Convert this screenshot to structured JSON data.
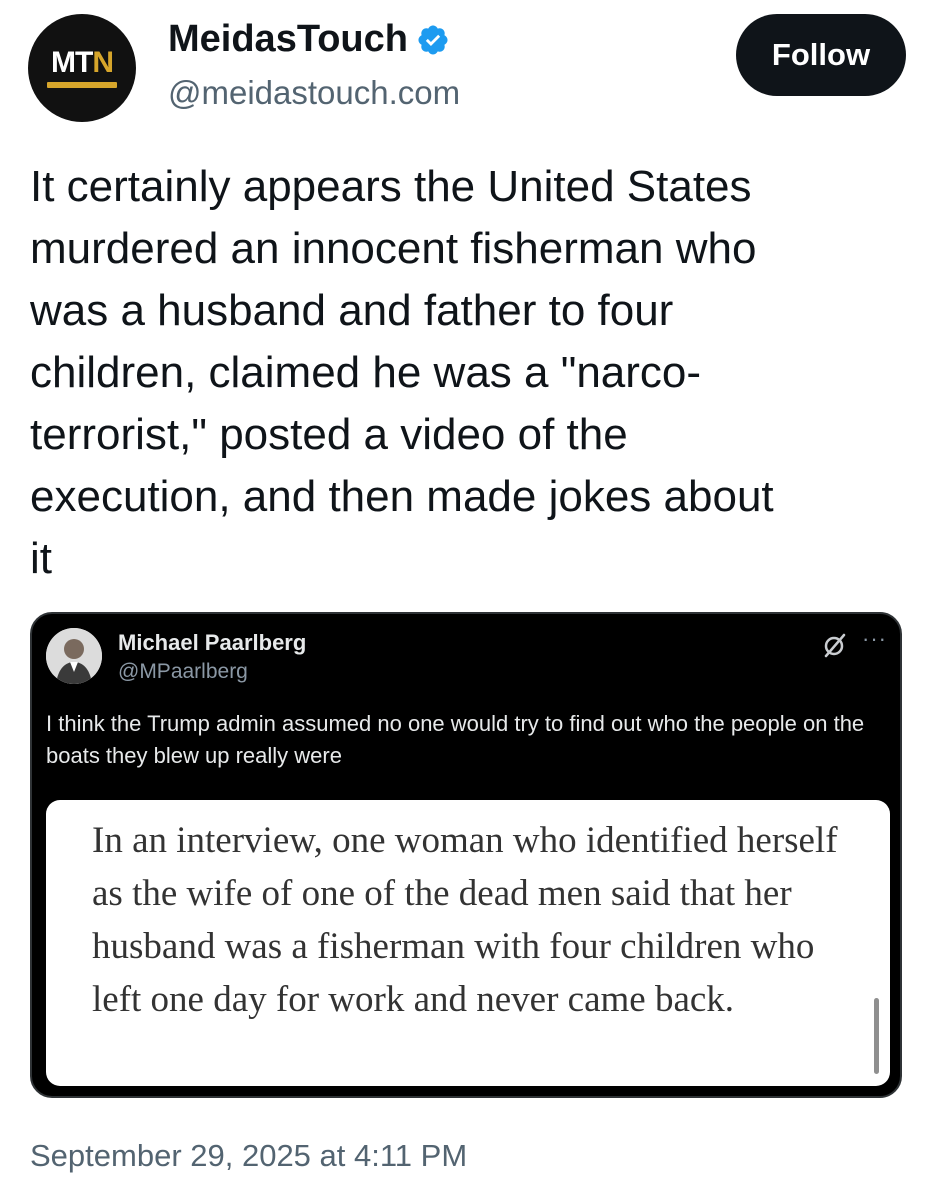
{
  "header": {
    "avatar_logo_text": "MTN",
    "display_name": "MeidasTouch",
    "handle": "@meidastouch.com",
    "verified_icon": "verified-badge-icon",
    "follow_label": "Follow"
  },
  "post": {
    "text": "It certainly appears the United States\nmurdered an innocent fisherman who\nwas a husband and father to four\nchildren, claimed he was a \"narco-\nterrorist,\" posted a video of the\nexecution, and then made jokes about\nit",
    "timestamp": "September 29, 2025 at 4:11 PM"
  },
  "quote": {
    "name": "Michael Paarlberg",
    "handle": "@MPaarlberg",
    "text": "I think the Trump admin assumed no one would try to find out who the people on the boats they blew up really were",
    "more_label": "···",
    "image_text": "In an interview, one woman who identified herself as the wife of one of the dead men said that her husband was a fisherman with four children who left one day for work and never came back."
  },
  "colors": {
    "accent_verified": "#1d9bf0",
    "follow_bg": "#0f1419",
    "quote_bg": "#000000",
    "logo_gold": "#d6a52b"
  }
}
